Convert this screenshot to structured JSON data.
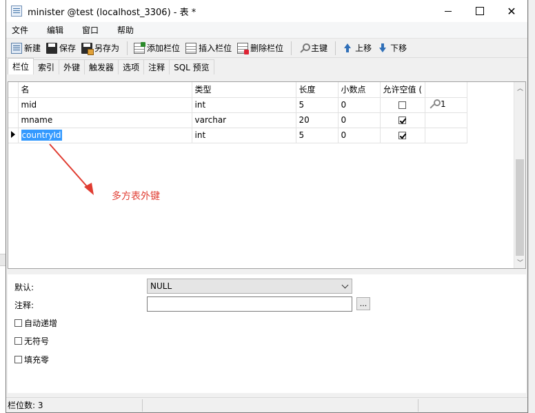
{
  "window": {
    "title": "minister @test (localhost_3306) - 表 *"
  },
  "menu": [
    "文件",
    "编辑",
    "窗口",
    "帮助"
  ],
  "toolbar": {
    "new": "新建",
    "save": "保存",
    "save_as": "另存为",
    "add_field": "添加栏位",
    "insert_field": "插入栏位",
    "delete_field": "删除栏位",
    "primary_key": "主键",
    "move_up": "上移",
    "move_down": "下移"
  },
  "tabs": [
    "栏位",
    "索引",
    "外键",
    "触发器",
    "选项",
    "注释",
    "SQL 预览"
  ],
  "grid": {
    "headers": [
      "名",
      "类型",
      "长度",
      "小数点",
      "允许空值 ("
    ],
    "rows": [
      {
        "name": "mid",
        "type": "int",
        "length": "5",
        "decimals": "0",
        "not_null": false,
        "key": "1"
      },
      {
        "name": "mname",
        "type": "varchar",
        "length": "20",
        "decimals": "0",
        "not_null": true,
        "key": ""
      },
      {
        "name": "countryId",
        "type": "int",
        "length": "5",
        "decimals": "0",
        "not_null": true,
        "key": ""
      }
    ]
  },
  "annotation": {
    "text": "多方表外键",
    "color": "#e03c31"
  },
  "properties": {
    "default_label": "默认:",
    "default_value": "NULL",
    "comment_label": "注释:",
    "comment_value": "",
    "ellipsis": "...",
    "auto_increment": "自动递增",
    "unsigned": "无符号",
    "zerofill": "填充零"
  },
  "status": {
    "field_count": "栏位数: 3"
  }
}
